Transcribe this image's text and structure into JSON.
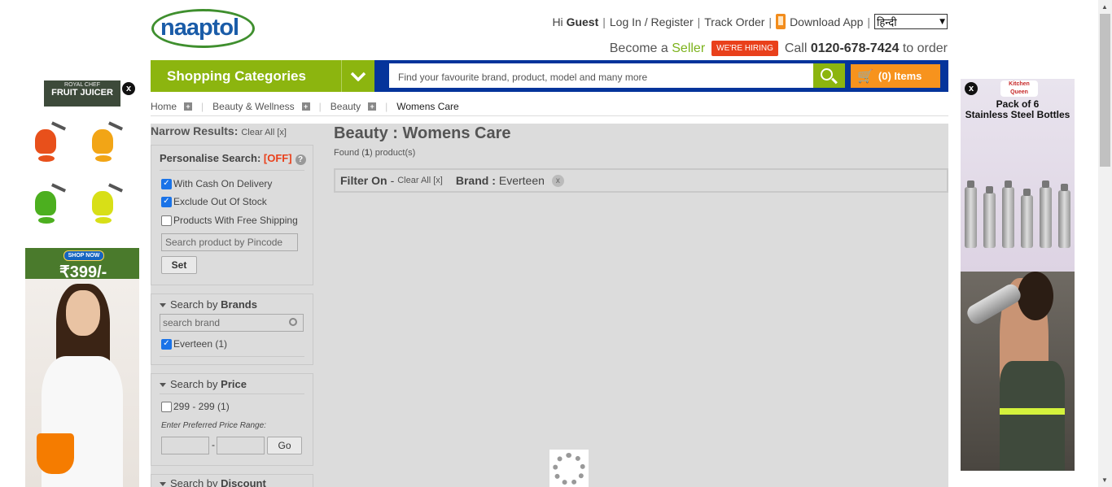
{
  "header": {
    "logo_text": "naaptol",
    "greeting": "Hi",
    "greeting_name": "Guest",
    "login_label": "Log In / Register",
    "track_label": "Track Order",
    "app_label": "Download App",
    "language": "हिन्दी",
    "become_label": "Become a",
    "seller_label": "Seller",
    "hiring_label": "WE'RE HIRING",
    "call_label": "Call",
    "phone": "0120-678-7424",
    "order_label": "to order"
  },
  "nav": {
    "categories_label": "Shopping Categories",
    "search_placeholder": "Find your favourite brand, product, model and many more",
    "cart_label": "(0) Items"
  },
  "breadcrumb": {
    "items": [
      "Home",
      "Beauty & Wellness",
      "Beauty"
    ],
    "current": "Womens Care"
  },
  "sidebar": {
    "narrow_title": "Narrow Results:",
    "clear_all": "Clear All [x]",
    "personalise_label": "Personalise Search:",
    "personalise_state": "[OFF]",
    "help_glyph": "?",
    "options": [
      {
        "label": "With Cash On Delivery",
        "checked": true
      },
      {
        "label": "Exclude Out Of Stock",
        "checked": true
      },
      {
        "label": "Products With Free Shipping",
        "checked": false
      }
    ],
    "pincode_placeholder": "Search product by Pincode",
    "set_label": "Set",
    "brands_prefix": "Search by",
    "brands_title": "Brands",
    "brand_search_placeholder": "search brand",
    "brand_items": [
      {
        "label": "Everteen (1)",
        "checked": true
      }
    ],
    "price_prefix": "Search by",
    "price_title": "Price",
    "price_items": [
      {
        "label": "299 - 299 (1)",
        "checked": false
      }
    ],
    "price_range_hint": "Enter Preferred Price Range:",
    "range_separator": "-",
    "go_label": "Go",
    "discount_prefix": "Search by",
    "discount_title": "Discount"
  },
  "main": {
    "title": "Beauty : Womens Care",
    "found_prefix": "Found (",
    "found_count": "1",
    "found_suffix": ") product(s)",
    "filter_on_label": "Filter On",
    "filter_dash": "-",
    "filter_clear": "Clear All [x]",
    "filter_brand_label": "Brand :",
    "filter_brand_value": "Everteen",
    "remove_glyph": "x"
  },
  "ads": {
    "left": {
      "brand_small": "ROYAL CHEF",
      "brand_title": "FRUIT JUICER",
      "shop_now": "SHOP NOW",
      "price": "₹399/-",
      "close_glyph": "x"
    },
    "right": {
      "brand_small": "Kitchen Queen",
      "line1": "Pack of 6",
      "line2": "Stainless Steel Bottles",
      "close_glyph": "x"
    }
  },
  "colors": {
    "brand_blue": "#05349b",
    "brand_green": "#8cb50f",
    "cart_orange": "#f7931d",
    "hiring_red": "#e9401b",
    "overlay_grey": "#dcdcdc"
  }
}
